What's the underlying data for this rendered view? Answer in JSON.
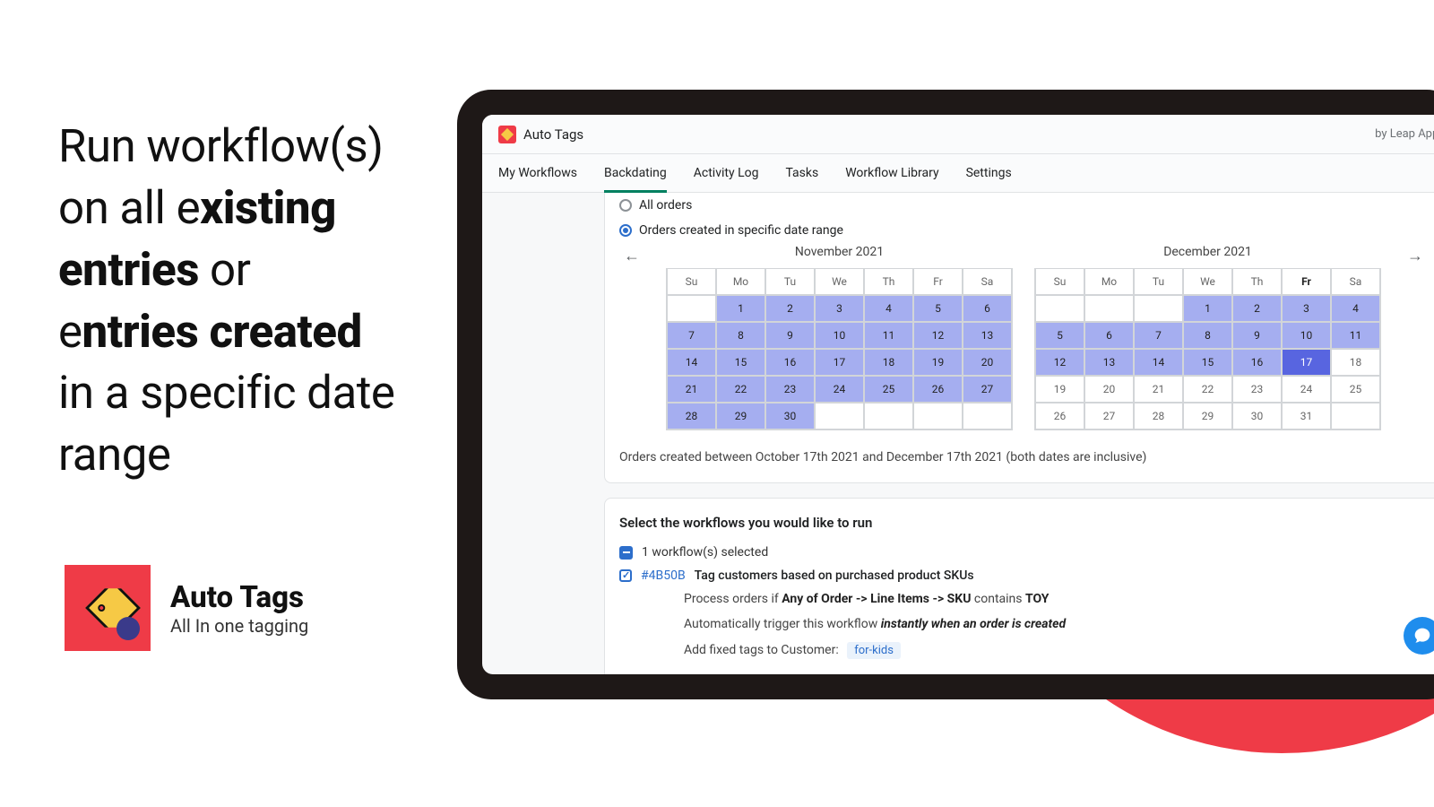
{
  "hero": {
    "part1": "Run workflow(s) on all e",
    "bold1": "xisting entries",
    "part2": " or e",
    "bold2": "ntries created",
    "part3": " in a specific date range"
  },
  "brand": {
    "name": "Auto Tags",
    "tagline": "All In one tagging"
  },
  "app": {
    "title": "Auto Tags",
    "vendor": "by Leap Apps"
  },
  "tabs": [
    "My Workflows",
    "Backdating",
    "Activity Log",
    "Tasks",
    "Workflow Library",
    "Settings"
  ],
  "active_tab": "Backdating",
  "radios": {
    "all": "All orders",
    "range": "Orders created in specific date range"
  },
  "calendars": {
    "left": {
      "title": "November 2021",
      "dows": [
        "Su",
        "Mo",
        "Tu",
        "We",
        "Th",
        "Fr",
        "Sa"
      ],
      "days": [
        {
          "n": "",
          "c": "empty"
        },
        {
          "n": "1",
          "c": "sel"
        },
        {
          "n": "2",
          "c": "sel"
        },
        {
          "n": "3",
          "c": "sel"
        },
        {
          "n": "4",
          "c": "sel"
        },
        {
          "n": "5",
          "c": "sel"
        },
        {
          "n": "6",
          "c": "sel"
        },
        {
          "n": "7",
          "c": "sel"
        },
        {
          "n": "8",
          "c": "sel"
        },
        {
          "n": "9",
          "c": "sel"
        },
        {
          "n": "10",
          "c": "sel"
        },
        {
          "n": "11",
          "c": "sel"
        },
        {
          "n": "12",
          "c": "sel"
        },
        {
          "n": "13",
          "c": "sel"
        },
        {
          "n": "14",
          "c": "sel"
        },
        {
          "n": "15",
          "c": "sel"
        },
        {
          "n": "16",
          "c": "sel"
        },
        {
          "n": "17",
          "c": "sel"
        },
        {
          "n": "18",
          "c": "sel"
        },
        {
          "n": "19",
          "c": "sel"
        },
        {
          "n": "20",
          "c": "sel"
        },
        {
          "n": "21",
          "c": "sel"
        },
        {
          "n": "22",
          "c": "sel"
        },
        {
          "n": "23",
          "c": "sel"
        },
        {
          "n": "24",
          "c": "sel"
        },
        {
          "n": "25",
          "c": "sel"
        },
        {
          "n": "26",
          "c": "sel"
        },
        {
          "n": "27",
          "c": "sel"
        },
        {
          "n": "28",
          "c": "sel"
        },
        {
          "n": "29",
          "c": "sel"
        },
        {
          "n": "30",
          "c": "sel"
        },
        {
          "n": "",
          "c": "empty"
        },
        {
          "n": "",
          "c": "empty"
        },
        {
          "n": "",
          "c": "empty"
        },
        {
          "n": "",
          "c": "empty"
        }
      ]
    },
    "right": {
      "title": "December 2021",
      "dows": [
        "Su",
        "Mo",
        "Tu",
        "We",
        "Th",
        "Fr",
        "Sa"
      ],
      "bold_dow": "Fr",
      "days": [
        {
          "n": "",
          "c": "empty"
        },
        {
          "n": "",
          "c": "empty"
        },
        {
          "n": "",
          "c": "empty"
        },
        {
          "n": "1",
          "c": "sel"
        },
        {
          "n": "2",
          "c": "sel"
        },
        {
          "n": "3",
          "c": "sel"
        },
        {
          "n": "4",
          "c": "sel"
        },
        {
          "n": "5",
          "c": "sel"
        },
        {
          "n": "6",
          "c": "sel"
        },
        {
          "n": "7",
          "c": "sel"
        },
        {
          "n": "8",
          "c": "sel"
        },
        {
          "n": "9",
          "c": "sel"
        },
        {
          "n": "10",
          "c": "sel"
        },
        {
          "n": "11",
          "c": "sel"
        },
        {
          "n": "12",
          "c": "sel"
        },
        {
          "n": "13",
          "c": "sel"
        },
        {
          "n": "14",
          "c": "sel"
        },
        {
          "n": "15",
          "c": "sel"
        },
        {
          "n": "16",
          "c": "sel"
        },
        {
          "n": "17",
          "c": "end"
        },
        {
          "n": "18",
          "c": ""
        },
        {
          "n": "19",
          "c": ""
        },
        {
          "n": "20",
          "c": ""
        },
        {
          "n": "21",
          "c": ""
        },
        {
          "n": "22",
          "c": ""
        },
        {
          "n": "23",
          "c": ""
        },
        {
          "n": "24",
          "c": ""
        },
        {
          "n": "25",
          "c": ""
        },
        {
          "n": "26",
          "c": ""
        },
        {
          "n": "27",
          "c": ""
        },
        {
          "n": "28",
          "c": ""
        },
        {
          "n": "29",
          "c": ""
        },
        {
          "n": "30",
          "c": ""
        },
        {
          "n": "31",
          "c": ""
        },
        {
          "n": "",
          "c": "empty"
        }
      ]
    }
  },
  "summary": "Orders created between October 17th 2021 and December 17th 2021 (both dates are inclusive)",
  "workflows": {
    "heading": "Select the workflows you would like to run",
    "selected_label": "1 workflow(s) selected",
    "item": {
      "id": "#4B50B",
      "name": "Tag customers based on purchased product SKUs",
      "process_prefix": "Process orders if ",
      "process_bold": "Any of Order -> Line Items -> SKU",
      "process_mid": " contains ",
      "process_bold2": "TOY",
      "trigger_prefix": "Automatically trigger this workflow ",
      "trigger_bold": "instantly when an order is created",
      "tags_label": "Add fixed tags to Customer:",
      "tag": "for-kids"
    }
  }
}
